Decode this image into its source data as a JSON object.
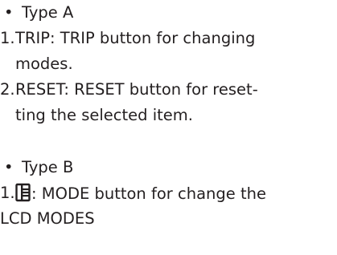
{
  "type_a": {
    "bullet": "•",
    "heading": "Type A",
    "items": [
      {
        "num": "1.",
        "line1": "TRIP: TRIP button for changing",
        "line2": "modes."
      },
      {
        "num": "2.",
        "line1": "RESET: RESET button for reset-",
        "line2": "ting the selected item."
      }
    ]
  },
  "type_b": {
    "bullet": "•",
    "heading": "Type B",
    "items": [
      {
        "num": "1.",
        "icon": "mode-document-icon",
        "line1": ": MODE button for change the",
        "line2": "LCD MODES"
      }
    ]
  },
  "colors": {
    "text": "#231f20",
    "background": "#ffffff"
  }
}
